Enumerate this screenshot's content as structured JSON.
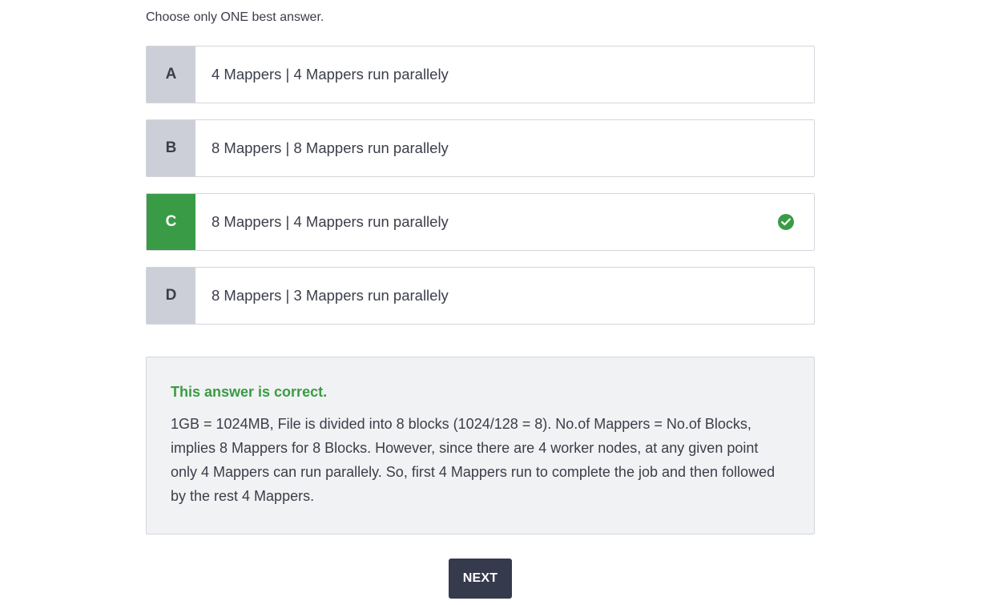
{
  "instruction": "Choose only ONE best answer.",
  "options": [
    {
      "letter": "A",
      "text": "4 Mappers | 4 Mappers run parallely",
      "correct": false
    },
    {
      "letter": "B",
      "text": "8 Mappers | 8 Mappers run parallely",
      "correct": false
    },
    {
      "letter": "C",
      "text": "8 Mappers | 4 Mappers run parallely",
      "correct": true
    },
    {
      "letter": "D",
      "text": "8 Mappers | 3 Mappers run parallely",
      "correct": false
    }
  ],
  "feedback": {
    "status": "This answer is correct.",
    "explanation": "1GB = 1024MB, File is divided into 8 blocks (1024/128 = 8). No.of Mappers = No.of Blocks, implies 8 Mappers for 8 Blocks. However, since there are 4 worker nodes, at any given point only 4 Mappers can run parallely. So, first 4 Mappers run to complete the job and then followed by the rest 4 Mappers."
  },
  "next_button": {
    "label": "NEXT"
  },
  "icons": {
    "correct": "check-circle-icon"
  },
  "colors": {
    "correct": "#3a9b46",
    "letter_bg": "#cdcfd8",
    "button_bg": "#363a4d",
    "feedback_bg": "#f1f2f3"
  }
}
